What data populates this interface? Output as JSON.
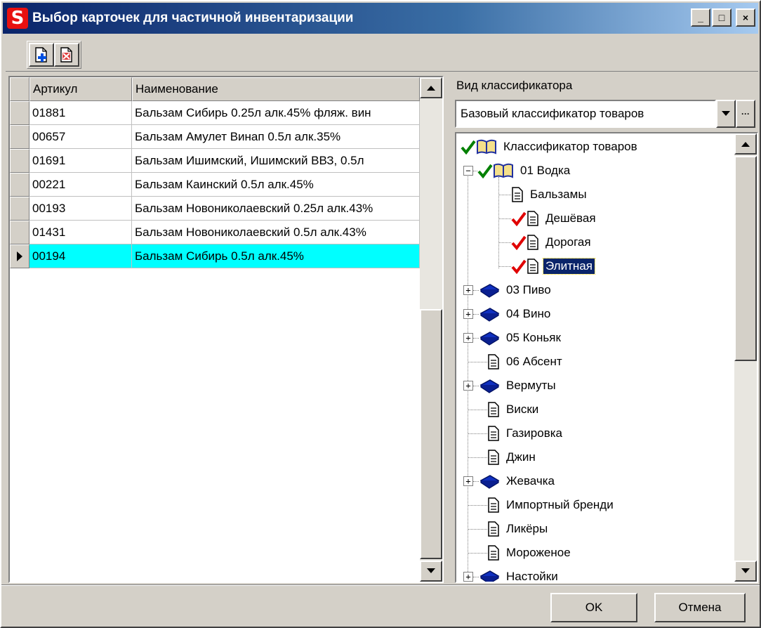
{
  "window": {
    "title": "Выбор карточек для частичной инвентаризации",
    "logo_letter": "S",
    "minimize": "_",
    "maximize": "□",
    "close": "×"
  },
  "toolbar": {
    "buttons": [
      {
        "icon": "add-document-icon"
      },
      {
        "icon": "remove-document-icon"
      }
    ]
  },
  "grid": {
    "columns": [
      "Артикул",
      "Наименование"
    ],
    "rows": [
      {
        "article": "01881",
        "name": "Бальзам Сибирь 0.25л алк.45% фляж. вин"
      },
      {
        "article": "00657",
        "name": "Бальзам Амулет Винап 0.5л алк.35%"
      },
      {
        "article": "01691",
        "name": "Бальзам Ишимский, Ишимский ВВЗ,  0.5л"
      },
      {
        "article": "00221",
        "name": "Бальзам Каинский 0.5л алк.45%"
      },
      {
        "article": "00193",
        "name": "Бальзам Новониколаевский 0.25л алк.43%"
      },
      {
        "article": "01431",
        "name": "Бальзам Новониколаевский 0.5л алк.43%"
      },
      {
        "article": "00194",
        "name": "Бальзам Сибирь 0.5л алк.45%",
        "selected": true
      }
    ]
  },
  "classifier": {
    "label": "Вид классификатора",
    "selected": "Базовый классификатор товаров",
    "ellipsis": "···"
  },
  "tree": {
    "nodes": [
      {
        "label": "Классификатор товаров",
        "checked": true,
        "icon": "book-open-icon"
      },
      {
        "label": "01 Водка",
        "checked": true,
        "icon": "book-open-icon",
        "expander": "−"
      },
      {
        "label": "Бальзамы",
        "icon": "document-icon"
      },
      {
        "label": "Дешёвая",
        "checked": true,
        "icon": "document-icon"
      },
      {
        "label": "Дорогая",
        "checked": true,
        "icon": "document-icon"
      },
      {
        "label": "Элитная",
        "checked": true,
        "icon": "document-icon",
        "selected": true
      },
      {
        "label": "03 Пиво",
        "icon": "book-closed-icon",
        "expander": "+"
      },
      {
        "label": "04 Вино",
        "icon": "book-closed-icon",
        "expander": "+"
      },
      {
        "label": "05 Коньяк",
        "icon": "book-closed-icon",
        "expander": "+"
      },
      {
        "label": "06 Абсент",
        "icon": "document-icon"
      },
      {
        "label": "Вермуты",
        "icon": "book-closed-icon",
        "expander": "+"
      },
      {
        "label": "Виски",
        "icon": "document-icon"
      },
      {
        "label": "Газировка",
        "icon": "document-icon"
      },
      {
        "label": "Джин",
        "icon": "document-icon"
      },
      {
        "label": "Жевачка",
        "icon": "book-closed-icon",
        "expander": "+"
      },
      {
        "label": "Импортный бренди",
        "icon": "document-icon"
      },
      {
        "label": "Ликёры",
        "icon": "document-icon"
      },
      {
        "label": "Мороженое",
        "icon": "document-icon"
      },
      {
        "label": "Настойки",
        "icon": "book-closed-icon",
        "expander": "+"
      }
    ]
  },
  "footer": {
    "ok": "OK",
    "cancel": "Отмена"
  }
}
